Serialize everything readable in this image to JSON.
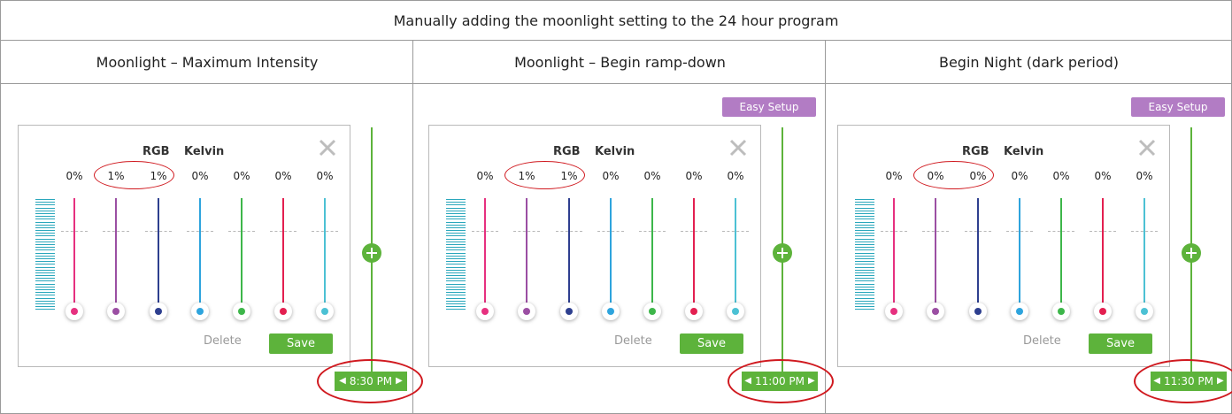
{
  "title": "Manually adding the moonlight setting to the 24 hour program",
  "columns": [
    {
      "header": "Moonlight – Maximum Intensity",
      "easy_setup": "",
      "rgb_label": "RGB",
      "kelvin_label": "Kelvin",
      "percents": [
        "0%",
        "1%",
        "1%",
        "0%",
        "0%",
        "0%",
        "0%"
      ],
      "delete_label": "Delete",
      "save_label": "Save",
      "time": "8:30 PM"
    },
    {
      "header": "Moonlight – Begin ramp-down",
      "easy_setup": "Easy Setup",
      "rgb_label": "RGB",
      "kelvin_label": "Kelvin",
      "percents": [
        "0%",
        "1%",
        "1%",
        "0%",
        "0%",
        "0%",
        "0%"
      ],
      "delete_label": "Delete",
      "save_label": "Save",
      "time": "11:00 PM"
    },
    {
      "header": "Begin Night (dark period)",
      "easy_setup": "Easy Setup",
      "rgb_label": "RGB",
      "kelvin_label": "Kelvin",
      "percents": [
        "0%",
        "0%",
        "0%",
        "0%",
        "0%",
        "0%",
        "0%"
      ],
      "delete_label": "Delete",
      "save_label": "Save",
      "time": "11:30 PM"
    }
  ],
  "channel_colors": [
    "#e6307f",
    "#9b4fa3",
    "#2e3f8f",
    "#2ea4dd",
    "#3db64a",
    "#e31f50",
    "#4cc1d4"
  ]
}
